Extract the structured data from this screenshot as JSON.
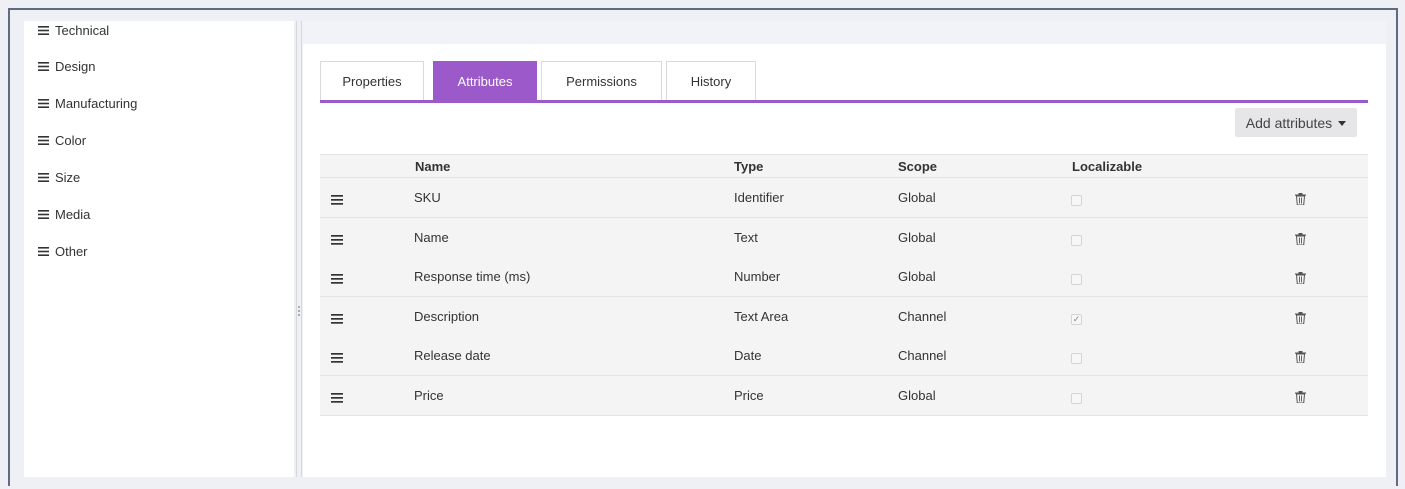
{
  "sidebar": {
    "items": [
      {
        "label": "Technical"
      },
      {
        "label": "Design"
      },
      {
        "label": "Manufacturing"
      },
      {
        "label": "Color"
      },
      {
        "label": "Size"
      },
      {
        "label": "Media"
      },
      {
        "label": "Other"
      }
    ]
  },
  "tabs": [
    {
      "label": "Properties",
      "active": false
    },
    {
      "label": "Attributes",
      "active": true
    },
    {
      "label": "Permissions",
      "active": false
    },
    {
      "label": "History",
      "active": false
    }
  ],
  "toolbar": {
    "add_attributes_label": "Add attributes"
  },
  "table": {
    "headers": {
      "name": "Name",
      "type": "Type",
      "scope": "Scope",
      "localizable": "Localizable"
    },
    "rows": [
      {
        "name": "SKU",
        "type": "Identifier",
        "scope": "Global",
        "localizable": false
      },
      {
        "name": "Name",
        "type": "Text",
        "scope": "Global",
        "localizable": false
      },
      {
        "name": "Response time (ms)",
        "type": "Number",
        "scope": "Global",
        "localizable": false
      },
      {
        "name": "Description",
        "type": "Text Area",
        "scope": "Channel",
        "localizable": true
      },
      {
        "name": "Release date",
        "type": "Date",
        "scope": "Channel",
        "localizable": false
      },
      {
        "name": "Price",
        "type": "Price",
        "scope": "Global",
        "localizable": false
      }
    ]
  },
  "colors": {
    "accent": "#9b59c9",
    "row_bg": "#f4f4f4",
    "frame": "#5e6b80"
  },
  "icons": {
    "menu": "hamburger-icon",
    "drag": "drag-handle-icon",
    "delete": "trash-icon",
    "caret": "caret-down-icon"
  }
}
